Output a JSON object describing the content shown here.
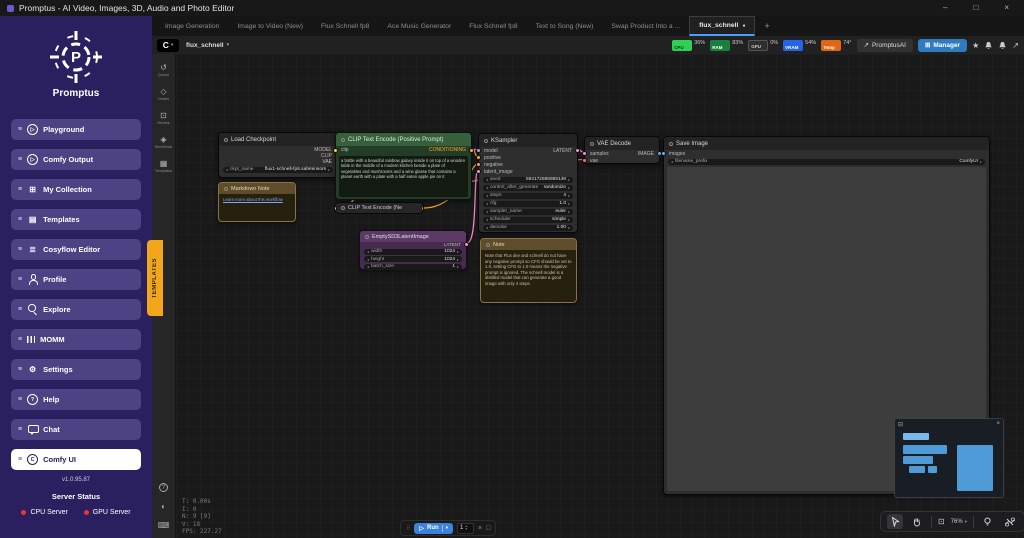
{
  "titlebar": {
    "title": "Promptus - AI Video, Images, 3D, Audio and Photo Editor"
  },
  "tabs": {
    "items": [
      "Image Generation",
      "Image to Video (New)",
      "Flux Schnell fp8",
      "Ace Music Generator",
      "Flux Schnell fp8",
      "Text to Song (New)",
      "Swap Product Into a ...",
      "flux_schnell"
    ],
    "active_index": 7
  },
  "topbar": {
    "workflow_name": "flux_schnell",
    "promptusai_label": "PromptusAI",
    "manager_label": "Manager"
  },
  "monitors": {
    "cpu_label": "CPU",
    "cpu_value": "36%",
    "ram_label": "RAM",
    "ram_value": "83%",
    "gpu_label": "GPU",
    "gpu_value": "0%",
    "vram_label": "VRAM",
    "vram_value": "54%",
    "temp_label": "Temp",
    "temp_value": "74°"
  },
  "sidebar": {
    "brand": "Promptus",
    "items": [
      "Playground",
      "Comfy Output",
      "My Collection",
      "Templates",
      "Cosyflow Editor",
      "Profile",
      "Explore",
      "MOMM",
      "Settings",
      "Help",
      "Chat",
      "Comfy UI"
    ],
    "active_item": "Comfy UI",
    "version": "v1.0.95.87",
    "server_status": "Server Status",
    "cpu_server": "CPU Server",
    "gpu_server": "GPU Server"
  },
  "templates_ribbon": "TEMPLATES",
  "rail": {
    "items": [
      "Queue",
      "Nodes",
      "Models",
      "Workflows",
      "Templates"
    ]
  },
  "nodes": {
    "load_checkpoint": {
      "title": "Load Checkpoint",
      "outputs": [
        "MODEL",
        "CLIP",
        "VAE"
      ],
      "widget": {
        "label": "ckpt_name",
        "value": "flux1-schnell-fp8.safetensors"
      }
    },
    "markdown_note": {
      "title": "Markdown Note",
      "link": "Learn more about this workflow"
    },
    "clip_positive": {
      "title": "CLIP Text Encode (Positive Prompt)",
      "input": "clip",
      "output": "CONDITIONING",
      "prompt": "a bottle with a beautiful rainbow galaxy inside it on top of a wooden table in the middle of a modern kitchen beside a plate of vegetables and mushrooms and a wine glasse that contains a planet earth with a plate with a half eaten apple pie on it"
    },
    "clip_negative": {
      "title": "CLIP Text Encode (Ne"
    },
    "empty_latent": {
      "title": "EmptySD3LatentImage",
      "output": "LATENT",
      "widgets": [
        {
          "label": "width",
          "value": "1024"
        },
        {
          "label": "height",
          "value": "1024"
        },
        {
          "label": "batch_size",
          "value": "1"
        }
      ]
    },
    "ksampler": {
      "title": "KSampler",
      "inputs": [
        "model",
        "positive",
        "negative",
        "latent_image"
      ],
      "output": "LATENT",
      "widgets": [
        {
          "label": "seed",
          "value": "594172696959149"
        },
        {
          "label": "control_after_generate",
          "value": "randomize"
        },
        {
          "label": "steps",
          "value": "4"
        },
        {
          "label": "cfg",
          "value": "1.0"
        },
        {
          "label": "sampler_name",
          "value": "euler"
        },
        {
          "label": "scheduler",
          "value": "simple"
        },
        {
          "label": "denoise",
          "value": "1.00"
        }
      ]
    },
    "vae_decode": {
      "title": "VAE Decode",
      "inputs": [
        "samples",
        "vae"
      ],
      "output": "IMAGE"
    },
    "save_image": {
      "title": "Save Image",
      "input": "images",
      "widget": {
        "label": "filename_prefix",
        "value": "ComfyUI"
      }
    },
    "note": {
      "title": "Note",
      "text": "Note that Flux dev and schnell do not have any negative prompt so CFG should be set to 1.0, setting CFG to 1.0 means the negative prompt is ignored. The schnell model is a distilled model that can generate a good image with only 4 steps."
    }
  },
  "stats": {
    "lines": [
      "T: 0.00s",
      "I: 0",
      "N: 9 [9]",
      "V: 18",
      "FPS: 227.27"
    ]
  },
  "run_bar": {
    "run_label": "Run",
    "count": "1"
  },
  "canvas_controls": {
    "zoom": "76%"
  },
  "icons": {
    "minimize": "–",
    "maximize": "□",
    "close": "×",
    "dot": "●",
    "plus": "+",
    "hamburger": "≡",
    "caret_down": "▾",
    "play": "▷",
    "grid": "⊞",
    "doc": "▤",
    "doc_lines": "≣",
    "gear": "⚙",
    "help": "?",
    "c_logo": "C",
    "queue": "↺",
    "nodes": "◇",
    "models": "⊡",
    "workflows": "◈",
    "templates": "▦",
    "moon": "◐",
    "keyboard": "⌨",
    "star": "★",
    "share": "↗",
    "manager_puzzle": "⊞",
    "fit": "⊡",
    "grip": "⠿",
    "stepper_up": "▴",
    "stepper_down": "▾",
    "stop": "□",
    "cancel": "×",
    "minimap_panel": "⊟"
  },
  "colors": {
    "accent_blue": "#4a9eff",
    "manager_blue": "#2e7cc0",
    "sidebar_purple": "#2a2060",
    "ribbon_yellow": "#f2a71b",
    "cpu_green": "#2fd154",
    "ram_green": "#17803b",
    "vram_blue": "#2563eb",
    "temp_orange": "#e06616",
    "wire_model": "#b79ded",
    "wire_clip": "#ffd52e",
    "wire_vae": "#ff6e6e",
    "wire_conditioning": "#ffa931",
    "wire_latent": "#ff8bd8",
    "wire_image": "#6bb2f0"
  }
}
